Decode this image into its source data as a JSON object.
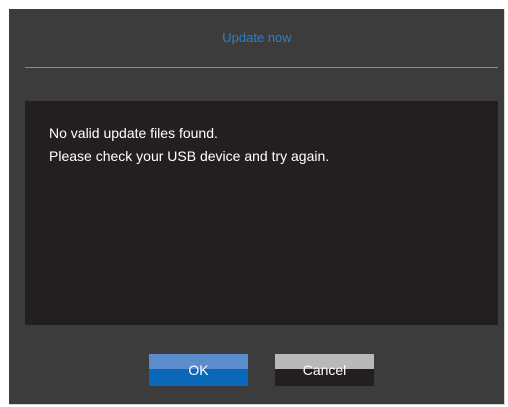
{
  "dialog": {
    "title": "Update now",
    "message_lines": [
      "No valid update files found.",
      "Please check your USB device and try again."
    ],
    "buttons": {
      "ok_label": "OK",
      "cancel_label": "Cancel"
    }
  },
  "colors": {
    "title_accent": "#2e7ec9",
    "dialog_background": "#3c3c3c",
    "message_background": "#231f20",
    "ok_button": "#0b68b8",
    "cancel_button_top": "#b9b9b9"
  }
}
